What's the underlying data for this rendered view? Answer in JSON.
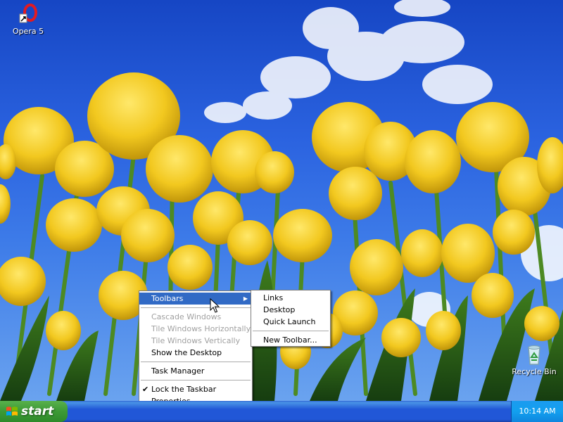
{
  "desktop": {
    "icons": [
      {
        "label": "Opera 5",
        "icon": "opera-icon"
      },
      {
        "label": "Recycle Bin",
        "icon": "recycle-bin-icon"
      }
    ]
  },
  "taskbar_menu": {
    "items": [
      {
        "label": "Toolbars",
        "state": "highlighted",
        "has_submenu": true
      },
      {
        "label": "Cascade Windows",
        "state": "disabled"
      },
      {
        "label": "Tile Windows Horizontally",
        "state": "disabled"
      },
      {
        "label": "Tile Windows Vertically",
        "state": "disabled"
      },
      {
        "label": "Show the Desktop",
        "state": "enabled"
      },
      {
        "label": "Task Manager",
        "state": "enabled"
      },
      {
        "label": "Lock the Taskbar",
        "state": "checked"
      },
      {
        "label": "Properties",
        "state": "enabled"
      }
    ]
  },
  "toolbars_submenu": {
    "items": [
      {
        "label": "Links"
      },
      {
        "label": "Desktop"
      },
      {
        "label": "Quick Launch"
      },
      {
        "label": "New Toolbar..."
      }
    ]
  },
  "taskbar": {
    "start_label": "start",
    "clock": "10:14 AM"
  },
  "colors": {
    "taskbar_blue": "#2157d7",
    "start_green": "#3c9a35",
    "menu_highlight": "#316ac5",
    "tulip_yellow": "#f2c81f",
    "sky_blue": "#2b63e0"
  }
}
